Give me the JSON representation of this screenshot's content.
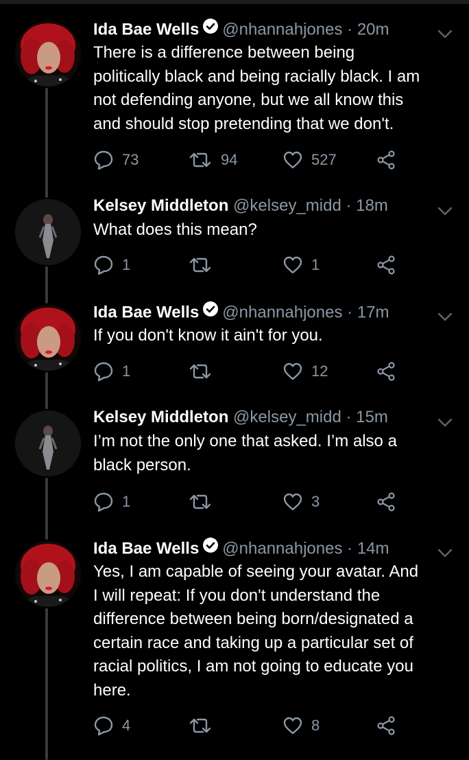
{
  "tweets": [
    {
      "name": "Ida Bae Wells",
      "verified": true,
      "handle": "@nhannahjones",
      "separator": "·",
      "time": "20m",
      "text": "There is a difference between being\npolitically black and being racially black. I am\nnot defending anyone, but we all know this\nand should stop pretending that we don't.",
      "replies": "73",
      "retweets": "94",
      "likes": "527"
    },
    {
      "name": "Kelsey Middleton",
      "verified": false,
      "handle": "@kelsey_midd",
      "separator": "·",
      "time": "18m",
      "text": "What does this mean?",
      "replies": "1",
      "retweets": "",
      "likes": "1"
    },
    {
      "name": "Ida Bae Wells",
      "verified": true,
      "handle": "@nhannahjones",
      "separator": "·",
      "time": "17m",
      "text": "If you don't know it ain't for you.",
      "replies": "1",
      "retweets": "",
      "likes": "12"
    },
    {
      "name": "Kelsey Middleton",
      "verified": false,
      "handle": "@kelsey_midd",
      "separator": "·",
      "time": "15m",
      "text": "I’m not the only one that asked. I’m also a\nblack person.",
      "replies": "1",
      "retweets": "",
      "likes": "3"
    },
    {
      "name": "Ida Bae Wells",
      "verified": true,
      "handle": "@nhannahjones",
      "separator": "·",
      "time": "14m",
      "text": "Yes, I am capable of seeing your avatar. And\nI will repeat: If you don't understand the\ndifference between being born/designated a\ncertain race and taking up a particular set of\nracial politics, I am not going to educate you\nhere.",
      "replies": "4",
      "retweets": "",
      "likes": "8"
    }
  ],
  "icons": {
    "reply": "reply-icon",
    "retweet": "retweet-icon",
    "like": "heart-icon",
    "share": "share-icon",
    "menu": "chevron-down-icon",
    "verified": "verified-badge-icon"
  },
  "colors": {
    "background": "#000000",
    "text": "#ffffff",
    "muted": "#8b98a5",
    "thread_line": "#3a3a3a",
    "ida_hair": "#b0121c",
    "ida_lips": "#e0142f"
  }
}
